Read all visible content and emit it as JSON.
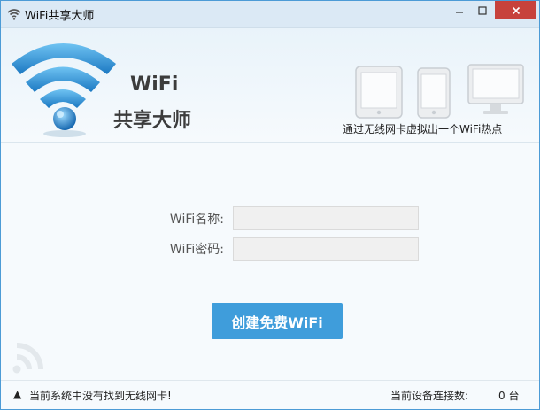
{
  "window": {
    "title": "WiFi共享大师"
  },
  "header": {
    "brand_line1": "WiFi",
    "brand_line2": "共享大师",
    "tagline": "通过无线网卡虚拟出一个WiFi热点"
  },
  "form": {
    "name_label": "WiFi名称:",
    "name_value": "",
    "password_label": "WiFi密码:",
    "password_value": "",
    "create_button": "创建免费WiFi"
  },
  "status": {
    "message": "当前系统中没有找到无线网卡!",
    "connections_label": "当前设备连接数:",
    "connections_value": "0 台"
  },
  "colors": {
    "accent": "#3f9ddb",
    "title_bar": "#dbe9f5",
    "close_button": "#c7423c"
  },
  "icons": [
    "wifi-icon",
    "minimize-icon",
    "maximize-icon",
    "close-icon",
    "wifi-logo-icon",
    "tablet-icon",
    "phone-icon",
    "monitor-icon",
    "warning-icon",
    "signal-icon"
  ]
}
